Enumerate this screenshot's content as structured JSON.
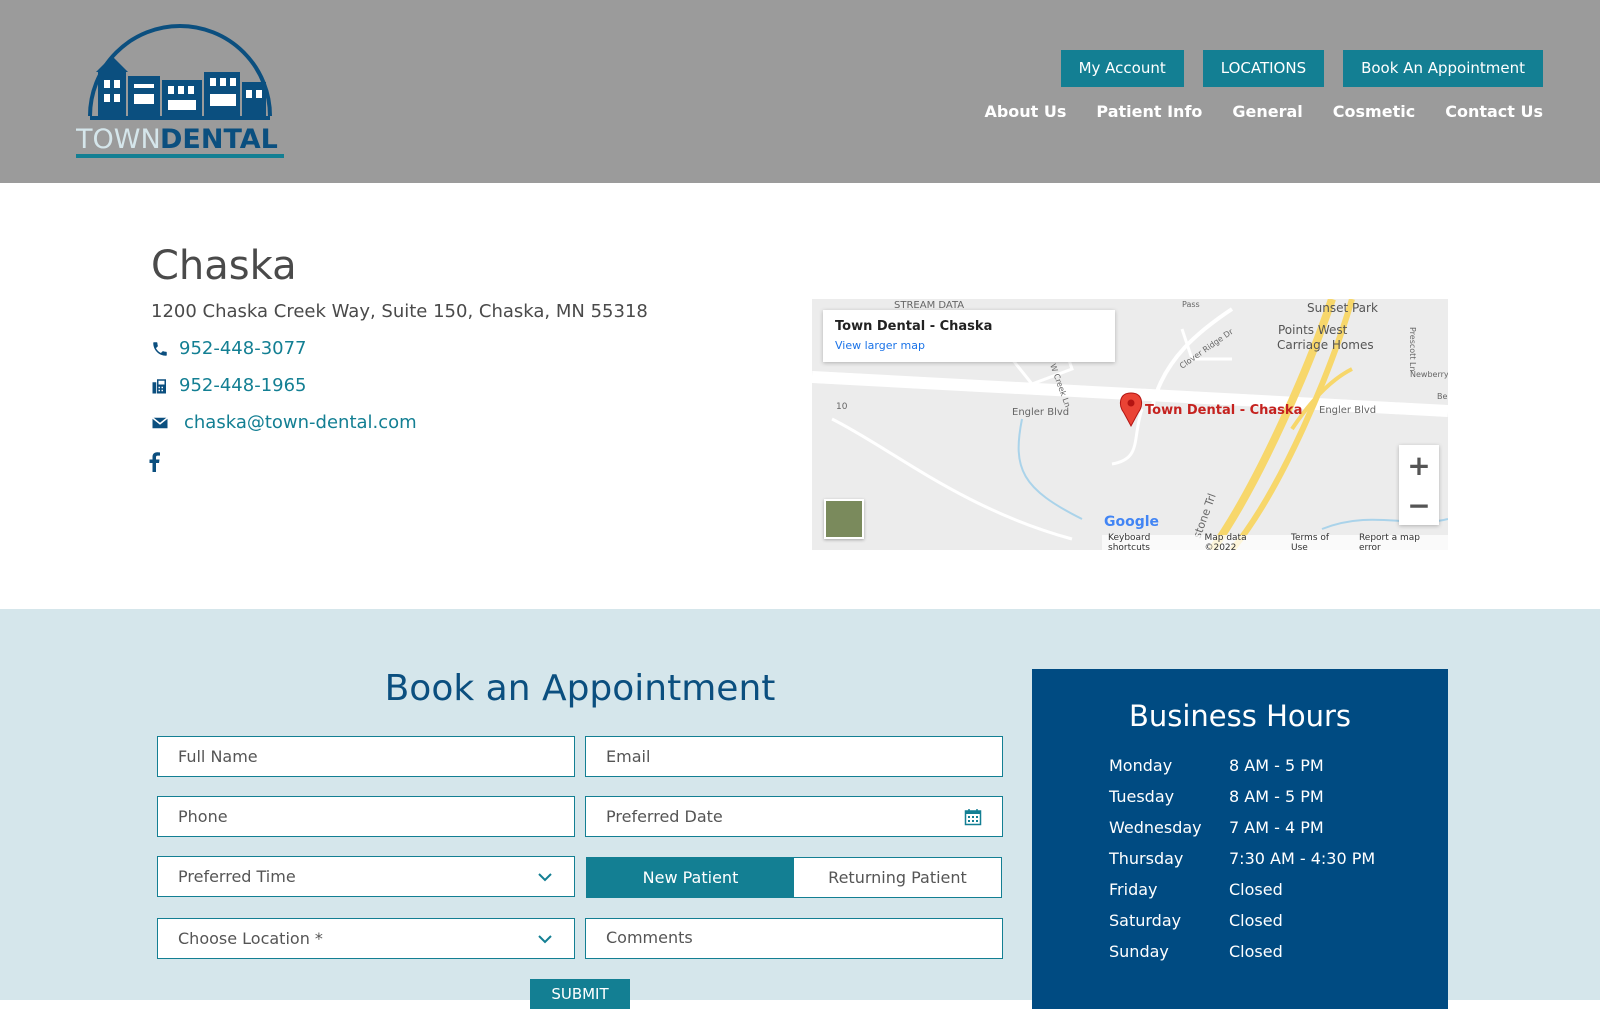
{
  "header": {
    "logo_text_town": "TOWN",
    "logo_text_dental": "DENTAL",
    "top_buttons": [
      "My Account",
      "LOCATIONS",
      "Book An Appointment"
    ],
    "nav": [
      "About Us",
      "Patient Info",
      "General",
      "Cosmetic",
      "Contact Us"
    ]
  },
  "location": {
    "title": "Chaska",
    "address": "1200 Chaska Creek Way, Suite 150, Chaska, MN 55318",
    "phone": "952-448-3077",
    "fax": "952-448-1965",
    "email": "chaska@town-dental.com",
    "icons": [
      "phone-icon",
      "fax-icon",
      "envelope-icon",
      "facebook-icon"
    ]
  },
  "map": {
    "card_title": "Town Dental - Chaska",
    "card_link": "View larger map",
    "pin_label": "Town Dental - Chaska",
    "labels": [
      "STREAM DATA",
      "Sunset Park",
      "Points West",
      "Carriage Homes",
      "Engler Blvd",
      "Engler Blvd",
      "10",
      "Clover Ridge Dr",
      "W Creek Ln",
      "Prescott Ln",
      "Newberry",
      "Pass",
      "stone Trl",
      "Be"
    ],
    "google": "Google",
    "footer": [
      "Keyboard shortcuts",
      "Map data ©2022",
      "Terms of Use",
      "Report a map error"
    ],
    "zoom_in": "+",
    "zoom_out": "−"
  },
  "booking": {
    "title": "Book an Appointment",
    "placeholders": {
      "full_name": "Full Name",
      "email": "Email",
      "phone": "Phone",
      "preferred_date": "Preferred Date",
      "preferred_time": "Preferred Time",
      "location": "Choose Location *",
      "comments": "Comments"
    },
    "patient_toggle": {
      "new": "New Patient",
      "returning": "Returning Patient",
      "selected": "New Patient"
    },
    "submit": "SUBMIT"
  },
  "hours": {
    "title": "Business Hours",
    "rows": [
      {
        "day": "Monday",
        "time": "8 AM - 5 PM"
      },
      {
        "day": "Tuesday",
        "time": "8 AM - 5 PM"
      },
      {
        "day": "Wednesday",
        "time": "7 AM - 4 PM"
      },
      {
        "day": "Thursday",
        "time": "7:30 AM - 4:30 PM"
      },
      {
        "day": "Friday",
        "time": "Closed"
      },
      {
        "day": "Saturday",
        "time": "Closed"
      },
      {
        "day": "Sunday",
        "time": "Closed"
      }
    ]
  },
  "colors": {
    "header_bg": "#9b9b9b",
    "accent": "#137f93",
    "navy": "#004b82",
    "booking_bg": "#d5e6eb"
  }
}
